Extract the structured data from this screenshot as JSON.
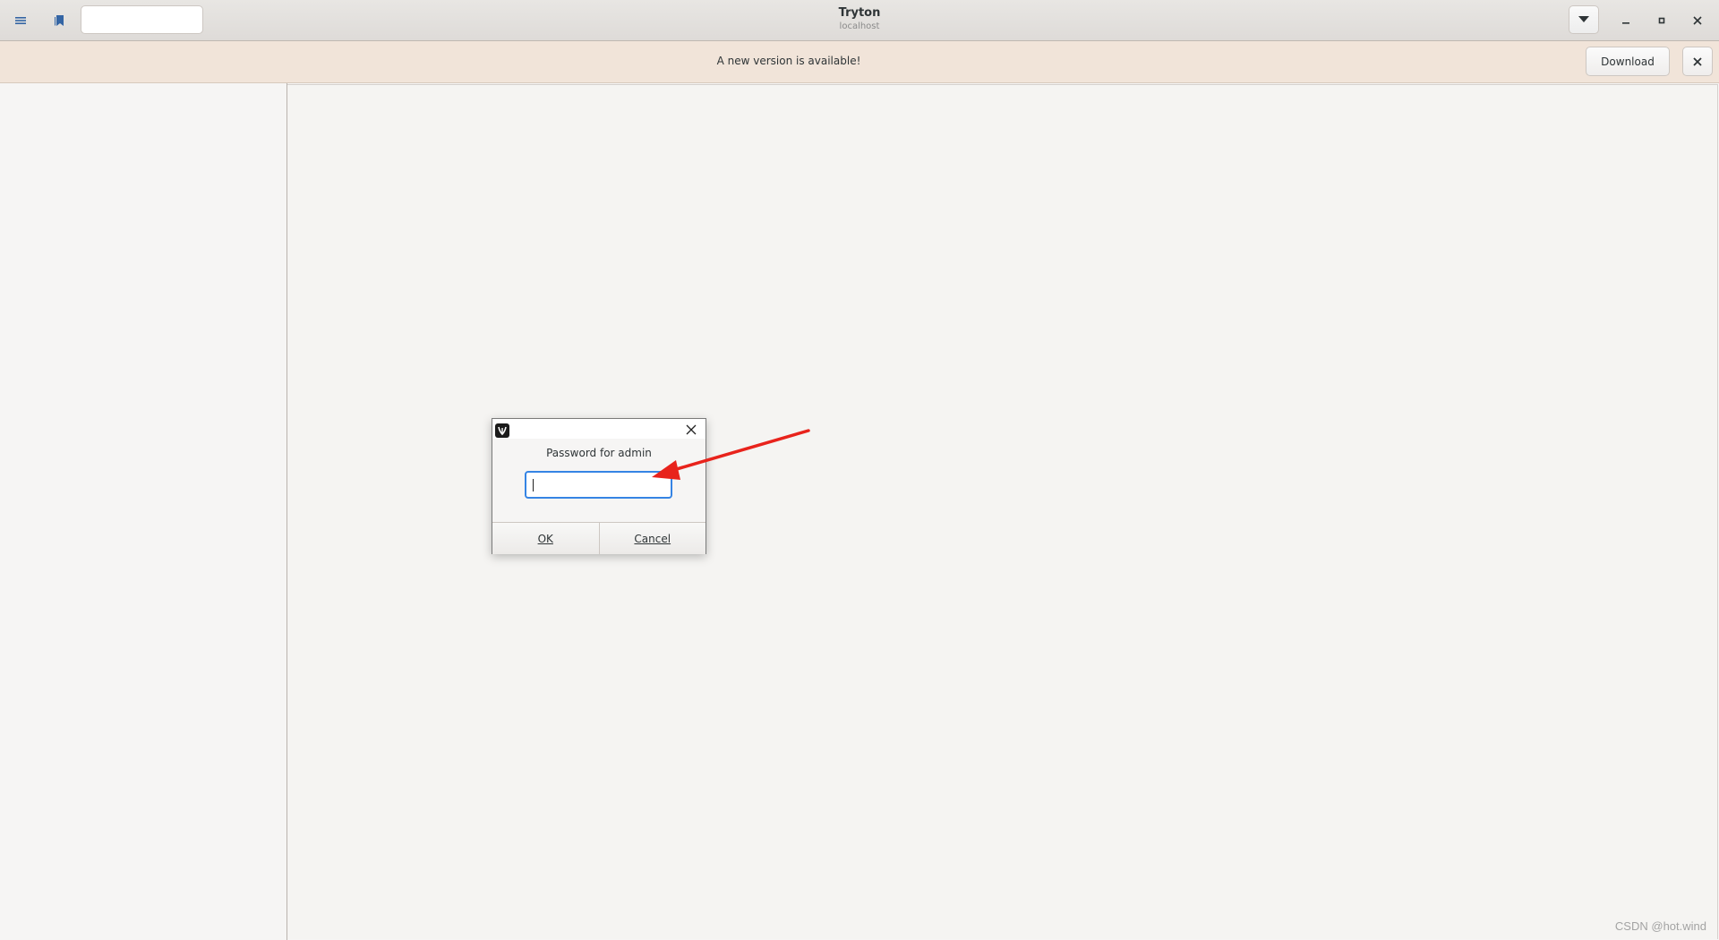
{
  "header": {
    "title": "Tryton",
    "subtitle": "localhost",
    "search_value": "",
    "icons": [
      "hamburger-menu-icon",
      "bookmark-icon",
      "chevron-down-icon",
      "minimize-icon",
      "maximize-icon",
      "close-icon"
    ]
  },
  "infobar": {
    "message": "A new version is available!",
    "download_label": "Download",
    "close_glyph": "✕"
  },
  "window_controls": {
    "minimize": "–",
    "maximize": "▪",
    "close": "✕"
  },
  "dialog": {
    "prompt": "Password for admin",
    "password_value": "",
    "ok_label": "OK",
    "cancel_label": "Cancel",
    "close_glyph": "✕"
  },
  "annotation": {
    "arrow_color": "#e8231c"
  },
  "watermark": "CSDN @hot.wind",
  "colors": {
    "accent": "#3584e4",
    "infobar_bg": "#f1e4d9",
    "bookmark": "#3465a4"
  }
}
